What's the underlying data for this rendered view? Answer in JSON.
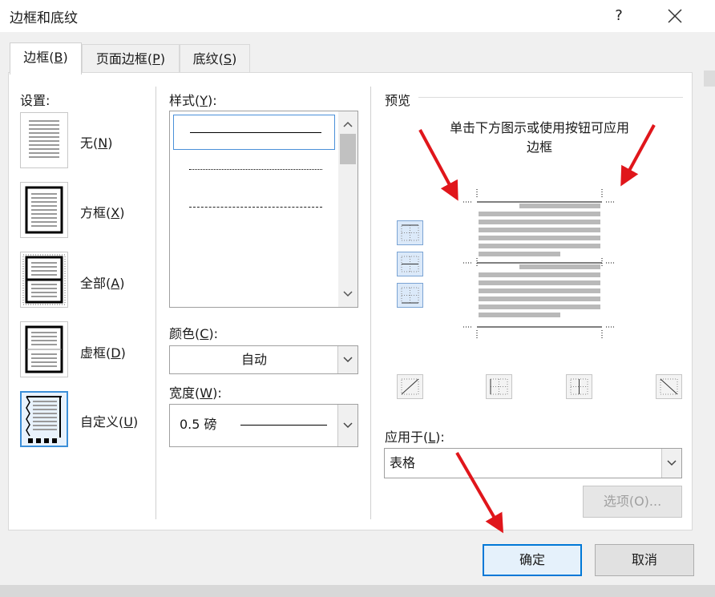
{
  "dialog": {
    "title": "边框和底纹",
    "help": "?"
  },
  "tabs": [
    {
      "label": "边框(",
      "key": "B",
      "end": ")",
      "active": true
    },
    {
      "label": "页面边框(",
      "key": "P",
      "end": ")",
      "active": false
    },
    {
      "label": "底纹(",
      "key": "S",
      "end": ")",
      "active": false
    }
  ],
  "settings": {
    "heading": "设置:",
    "items": [
      {
        "label": "无(",
        "key": "N",
        "end": ")"
      },
      {
        "label": "方框(",
        "key": "X",
        "end": ")"
      },
      {
        "label": "全部(",
        "key": "A",
        "end": ")"
      },
      {
        "label": "虚框(",
        "key": "D",
        "end": ")"
      },
      {
        "label": "自定义(",
        "key": "U",
        "end": ")",
        "selected": true
      }
    ]
  },
  "style": {
    "heading": "样式(",
    "key": "Y",
    "end": "):",
    "lines": [
      "solid",
      "dotted",
      "dashed-fine",
      "dashed",
      "dash-dot"
    ]
  },
  "color": {
    "heading": "颜色(",
    "key": "C",
    "end": "):",
    "value": "自动"
  },
  "width": {
    "heading": "宽度(",
    "key": "W",
    "end": "):",
    "value": "0.5 磅"
  },
  "preview": {
    "heading": "预览",
    "hint_line1": "单击下方图示或使用按钮可应用",
    "hint_line2": "边框"
  },
  "apply_to": {
    "heading": "应用于(",
    "key": "L",
    "end": "):",
    "value": "表格"
  },
  "buttons": {
    "options": "选项(O)...",
    "ok": "确定",
    "cancel": "取消"
  },
  "colors": {
    "accent": "#0078d7",
    "annotation_arrow": "#e0161b"
  }
}
